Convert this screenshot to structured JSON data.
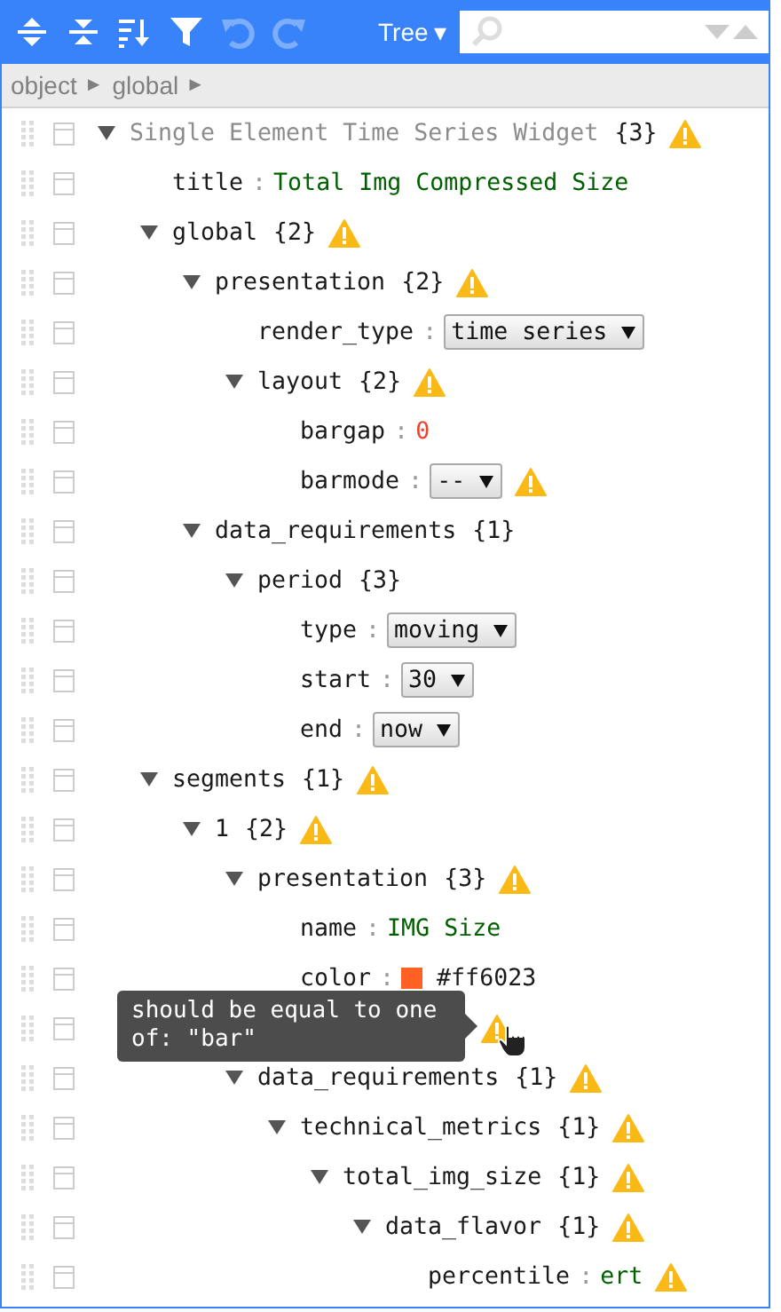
{
  "toolbar": {
    "buttons": [
      {
        "kind": "expand-all",
        "disabled": false
      },
      {
        "kind": "collapse-all",
        "disabled": false
      },
      {
        "kind": "sort",
        "disabled": false
      },
      {
        "kind": "filter",
        "disabled": false
      },
      {
        "kind": "undo",
        "disabled": true
      },
      {
        "kind": "redo",
        "disabled": true
      }
    ],
    "mode": {
      "label": "Tree",
      "caret": "▾"
    }
  },
  "navigation": [
    {
      "label": "object",
      "sep": "►"
    },
    {
      "label": "global",
      "sep": "►"
    }
  ],
  "tree": {
    "key": "Single Element Time Series Widget",
    "count": "{3}",
    "expanded": true,
    "warning": true,
    "children": [
      {
        "key": "title",
        "sep": ":",
        "value": {
          "kind": "string",
          "text": "Total Img Compressed Size"
        }
      },
      {
        "key": "global",
        "count": "{2}",
        "expanded": true,
        "warning": true,
        "children": [
          {
            "key": "presentation",
            "count": "{2}",
            "expanded": true,
            "warning": true,
            "children": [
              {
                "key": "render_type",
                "sep": ":",
                "value": {
                  "kind": "select",
                  "text": "time series"
                }
              },
              {
                "key": "layout",
                "count": "{2}",
                "expanded": true,
                "warning": true,
                "children": [
                  {
                    "key": "bargap",
                    "sep": ":",
                    "value": {
                      "kind": "number",
                      "text": "0"
                    }
                  },
                  {
                    "key": "barmode",
                    "sep": ":",
                    "value": {
                      "kind": "select",
                      "text": "--"
                    },
                    "warning": true
                  }
                ]
              }
            ]
          },
          {
            "key": "data_requirements",
            "count": "{1}",
            "expanded": true,
            "children": [
              {
                "key": "period",
                "count": "{3}",
                "expanded": true,
                "children": [
                  {
                    "key": "type",
                    "sep": ":",
                    "value": {
                      "kind": "select",
                      "text": "moving"
                    }
                  },
                  {
                    "key": "start",
                    "sep": ":",
                    "value": {
                      "kind": "select",
                      "text": "30"
                    }
                  },
                  {
                    "key": "end",
                    "sep": ":",
                    "value": {
                      "kind": "select",
                      "text": "now"
                    }
                  }
                ]
              }
            ]
          }
        ]
      },
      {
        "key": "segments",
        "count": "{1}",
        "expanded": true,
        "warning": true,
        "children": [
          {
            "key": "1",
            "count": "{2}",
            "expanded": true,
            "warning": true,
            "children": [
              {
                "key": "presentation",
                "count": "{3}",
                "expanded": true,
                "warning": true,
                "children": [
                  {
                    "key": "name",
                    "sep": ":",
                    "value": {
                      "kind": "string",
                      "text": "IMG Size"
                    }
                  },
                  {
                    "key": "color",
                    "sep": ":",
                    "value": {
                      "kind": "color",
                      "text": "#ff6023",
                      "color": "#ff6023"
                    }
                  },
                  {
                    "warning": true,
                    "tooltip": "should be equal to one of: \"bar\""
                  }
                ]
              },
              {
                "key": "data_requirements",
                "count": "{1}",
                "expanded": true,
                "warning": true,
                "children": [
                  {
                    "key": "technical_metrics",
                    "count": "{1}",
                    "expanded": true,
                    "warning": true,
                    "children": [
                      {
                        "key": "total_img_size",
                        "count": "{1}",
                        "expanded": true,
                        "warning": true,
                        "children": [
                          {
                            "key": "data_flavor",
                            "count": "{1}",
                            "expanded": true,
                            "warning": true,
                            "children": [
                              {
                                "key": "percentile",
                                "sep": ":",
                                "value": {
                                  "kind": "string",
                                  "text": "ert"
                                },
                                "warning": true
                              }
                            ]
                          }
                        ]
                      }
                    ]
                  }
                ]
              }
            ]
          }
        ]
      }
    ]
  }
}
